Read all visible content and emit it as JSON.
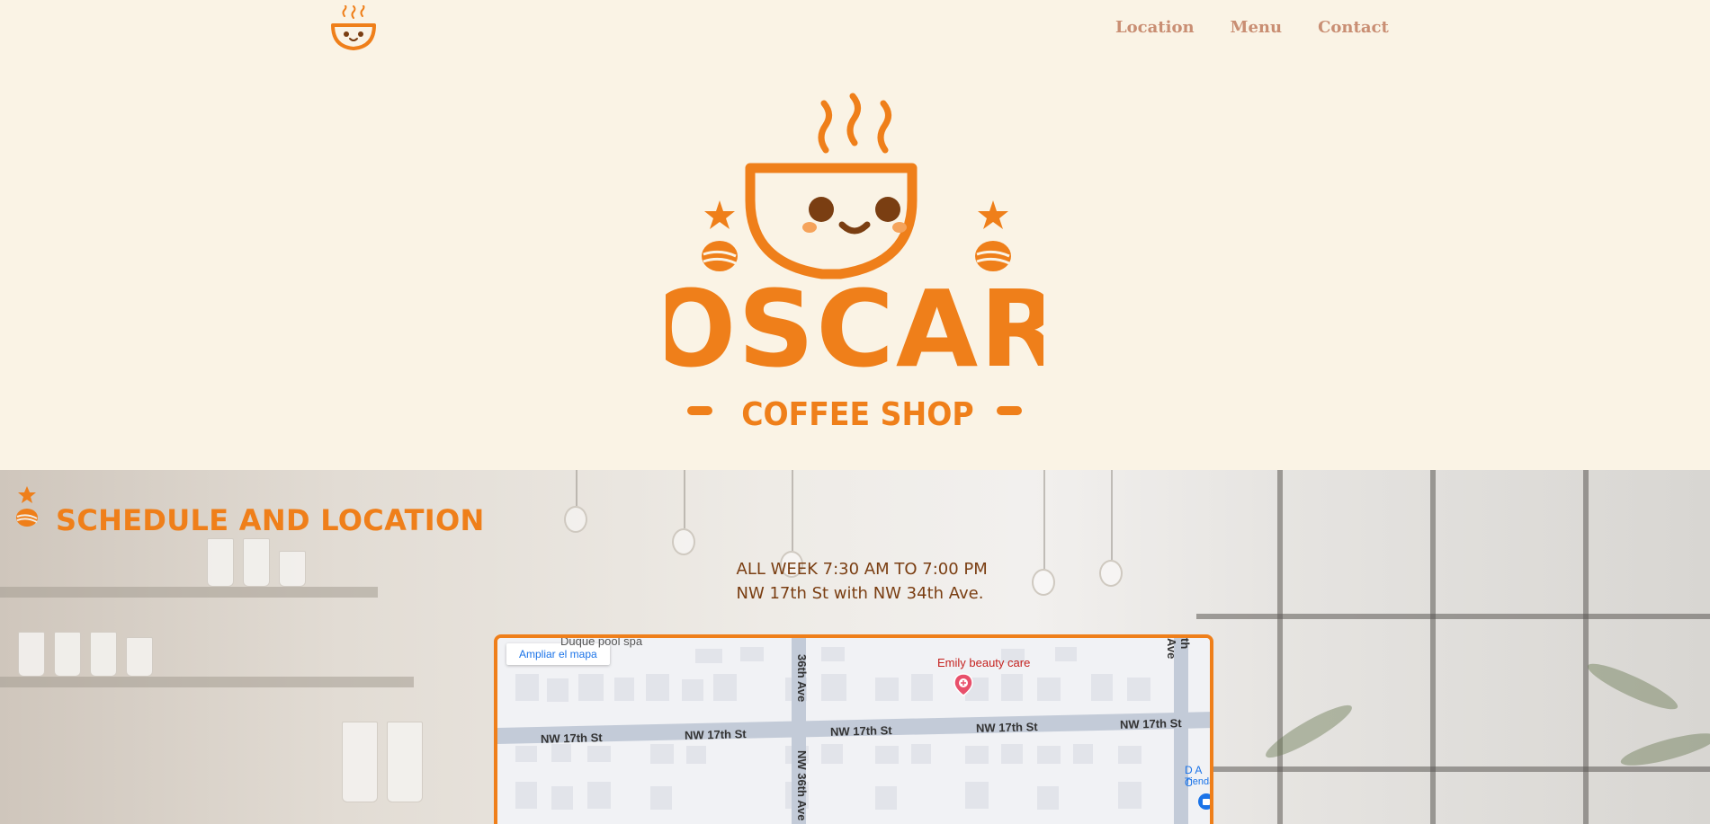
{
  "nav": {
    "logo_alt": "oscar-cup-icon",
    "links": [
      "Location",
      "Menu",
      "Contact"
    ]
  },
  "hero": {
    "brand_name": "OSCAR",
    "brand_tagline": "COFFEE SHOP"
  },
  "schedule": {
    "title": "SCHEDULE AND LOCATION",
    "hours": "ALL WEEK 7:30 AM TO 7:00 PM",
    "address": "NW 17th St with NW 34th Ave."
  },
  "map": {
    "expand_label": "Ampliar el mapa",
    "street_h": [
      "NW 17th St",
      "NW 17th St",
      "NW 17th St",
      "NW 17th St",
      "NW 17th St"
    ],
    "street_v1": "NW 36th Ave",
    "street_v1_top": "36th Ave",
    "street_v2_top": "th Ave",
    "poi_name": "Emily beauty care",
    "top_label": "Duque pool spa",
    "right_label_1": "D A C",
    "right_label_2": "Tienda"
  },
  "colors": {
    "brand_orange": "#EF7F1A",
    "nav_link": "#C98E73",
    "text_brown": "#7A3E12",
    "background": "#FAF3E5"
  }
}
